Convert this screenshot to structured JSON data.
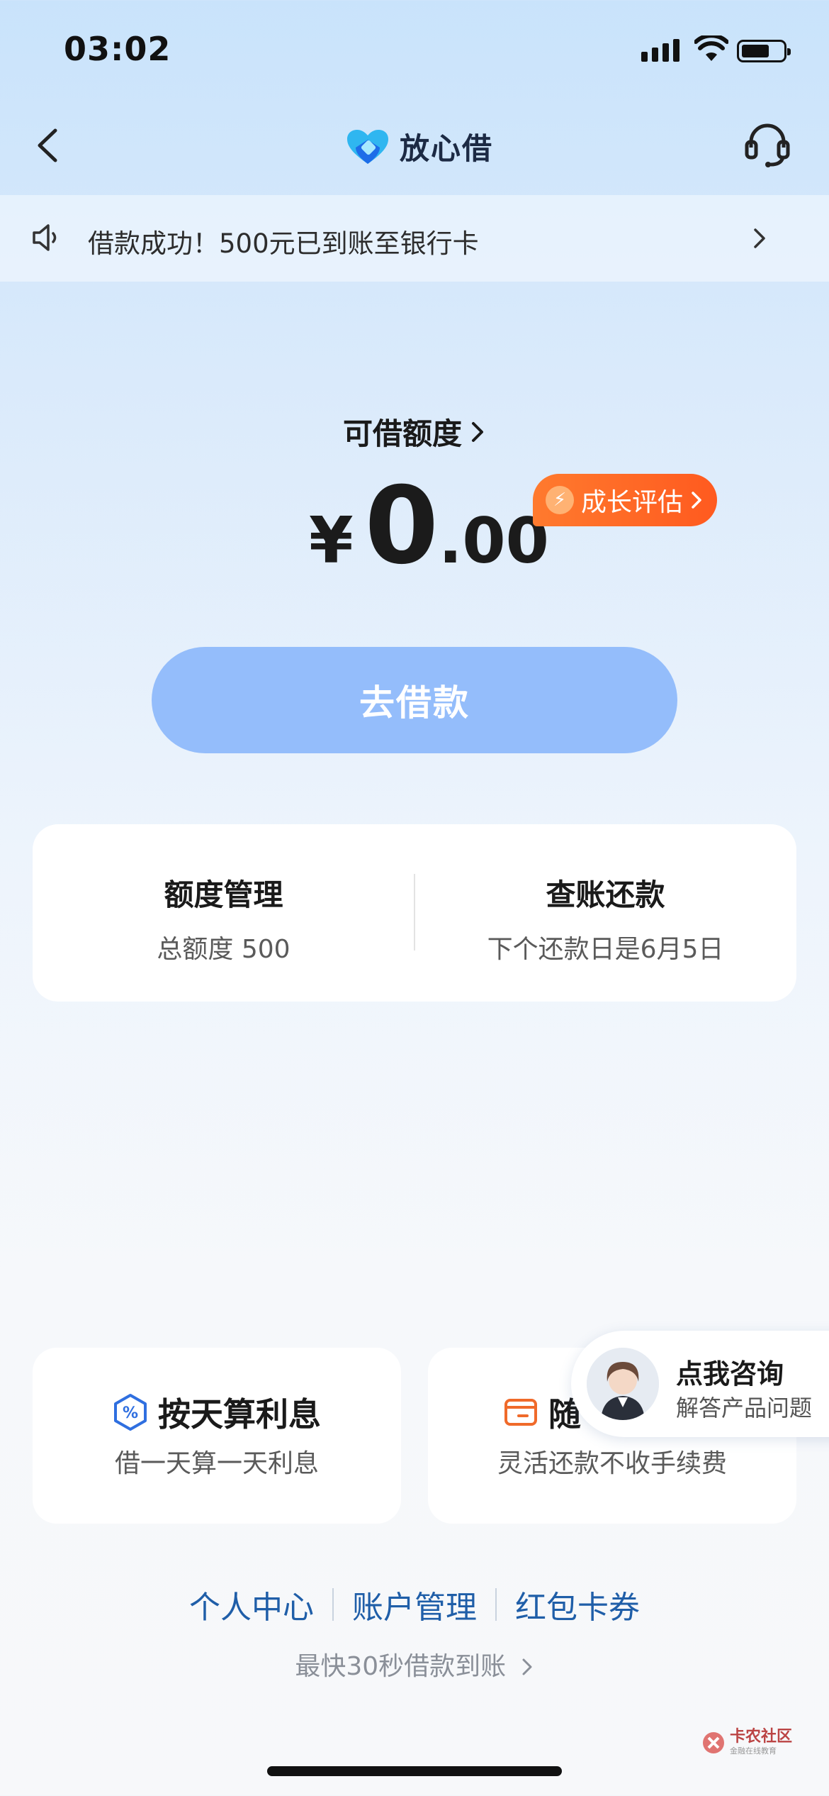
{
  "status_bar": {
    "time": "03:02"
  },
  "nav": {
    "title": "放心借"
  },
  "notice": {
    "text": "借款成功！500元已到账至银行卡"
  },
  "credit": {
    "label": "可借额度",
    "currency": "¥",
    "amount_integer": "0",
    "amount_decimal": ".00",
    "growth_badge": "成长评估"
  },
  "borrow_button": {
    "label": "去借款"
  },
  "summary": {
    "left": {
      "title": "额度管理",
      "subtitle": "总额度 500"
    },
    "right": {
      "title": "查账还款",
      "subtitle": "下个还款日是6月5日"
    }
  },
  "features": {
    "left": {
      "title": "按天算利息",
      "subtitle": "借一天算一天利息"
    },
    "right": {
      "title": "随",
      "subtitle": "灵活还款不收手续费"
    }
  },
  "consult": {
    "title": "点我咨询",
    "subtitle": "解答产品问题"
  },
  "links": [
    "个人中心",
    "账户管理",
    "红包卡券"
  ],
  "fast_text": "最快30秒借款到账",
  "watermark": {
    "title": "卡农社区",
    "subtitle": "金融在线教育"
  },
  "colors": {
    "primary_button": "#94bdfb",
    "badge": "#ff6a26",
    "link": "#1f5ea8"
  }
}
